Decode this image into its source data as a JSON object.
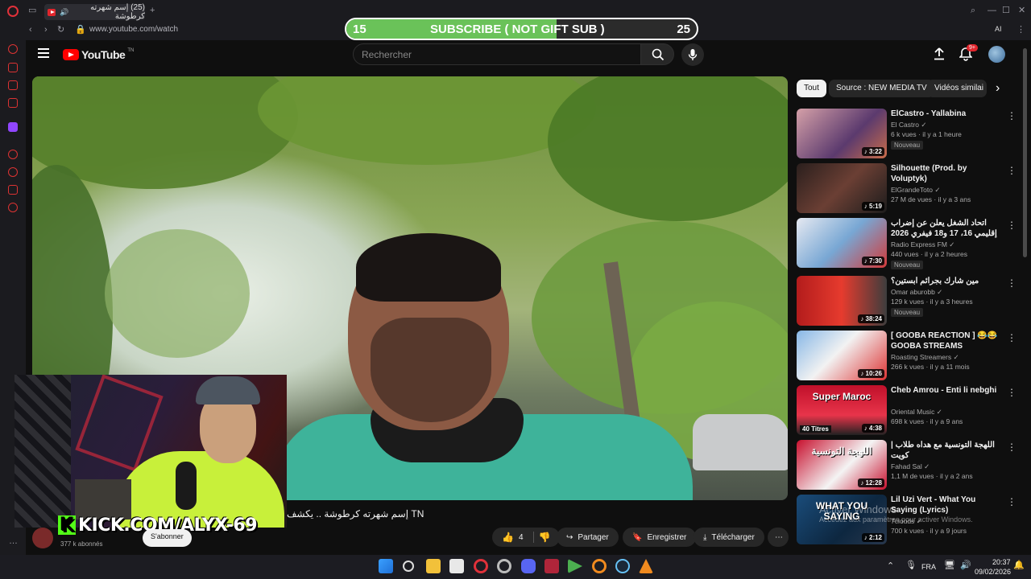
{
  "browser": {
    "tab_title": "(25) إسم شهرته كرطوشة",
    "url": "www.youtube.com/watch",
    "ai_label": "AI"
  },
  "overlay": {
    "sub_current": "15",
    "sub_goal": "25",
    "sub_text": "SUBSCRIBE ( NOT GIFT SUB )",
    "progress_fraction": 0.6,
    "kick_text": "KICK.COM/ALYX-69"
  },
  "youtube": {
    "logo_text": "YouTube",
    "logo_suffix": "TN",
    "search_placeholder": "Rechercher",
    "notif_count": "9+"
  },
  "video": {
    "title": "TN إسم شهرته كرطوشة .. يكشف",
    "subscriber_count": "377 k abonnés",
    "subscribe_label": "S'abonner",
    "like_count": "4",
    "share_label": "Partager",
    "save_label": "Enregistrer",
    "download_label": "Télécharger"
  },
  "chips": [
    "Tout",
    "Source : NEW MEDIA TV",
    "Vidéos similai"
  ],
  "recommendations": [
    {
      "title": "ElCastro - Yallabina",
      "channel": "El Castro",
      "meta": "6 k vues · il y a 1 heure",
      "badge": "Nouveau",
      "duration": "3:22"
    },
    {
      "title": "Silhouette (Prod. by Voluptyk)",
      "channel": "ElGrandeToto",
      "meta": "27 M de vues · il y a 3 ans",
      "badge": "",
      "duration": "5:19"
    },
    {
      "title": "اتحاد الشغل يعلن عن إضراب إقليمي 16، 17 و18 فيفري 2026",
      "channel": "Radio Express FM",
      "meta": "440 vues · il y a 2 heures",
      "badge": "Nouveau",
      "duration": "7:30"
    },
    {
      "title": "مين شارك بجرائم ابستين؟",
      "channel": "Omar aburobb",
      "meta": "129 k vues · il y a 3 heures",
      "badge": "Nouveau",
      "duration": "38:24"
    },
    {
      "title": "[ GOOBA REACTION ] 😂😂 GOOBA STREAMS HIGHLIGHT...",
      "channel": "Roasting Streamers",
      "meta": "266 k vues · il y a 11 mois",
      "badge": "",
      "duration": "10:26"
    },
    {
      "title": "Cheb Amrou - Enti li nebghi",
      "channel": "Oriental Music",
      "meta": "698 k vues · il y a 9 ans",
      "badge": "",
      "duration": "4:38",
      "thumb_text": "Super Maroc",
      "thumb_sub": "40 Titres"
    },
    {
      "title": "اللهجة التونسية مع هداه طلاب | كويت",
      "channel": "Fahad Sal",
      "meta": "1,1 M de vues · il y a 2 ans",
      "badge": "",
      "duration": "12:28",
      "thumb_text": "اللهجة التونسية"
    },
    {
      "title": "Lil Uzi Vert - What You Saying (Lyrics)",
      "channel": "7clouds",
      "meta": "700 k vues · il y a 9 jours",
      "badge": "",
      "duration": "2:12",
      "thumb_text": "WHAT YOU SAYING"
    }
  ],
  "watermark": {
    "line1": "Activer Windows",
    "line2": "Accédez aux paramètres pour activer Windows."
  },
  "taskbar": {
    "language": "FRA",
    "time": "20:37",
    "date": "09/02/2026"
  }
}
